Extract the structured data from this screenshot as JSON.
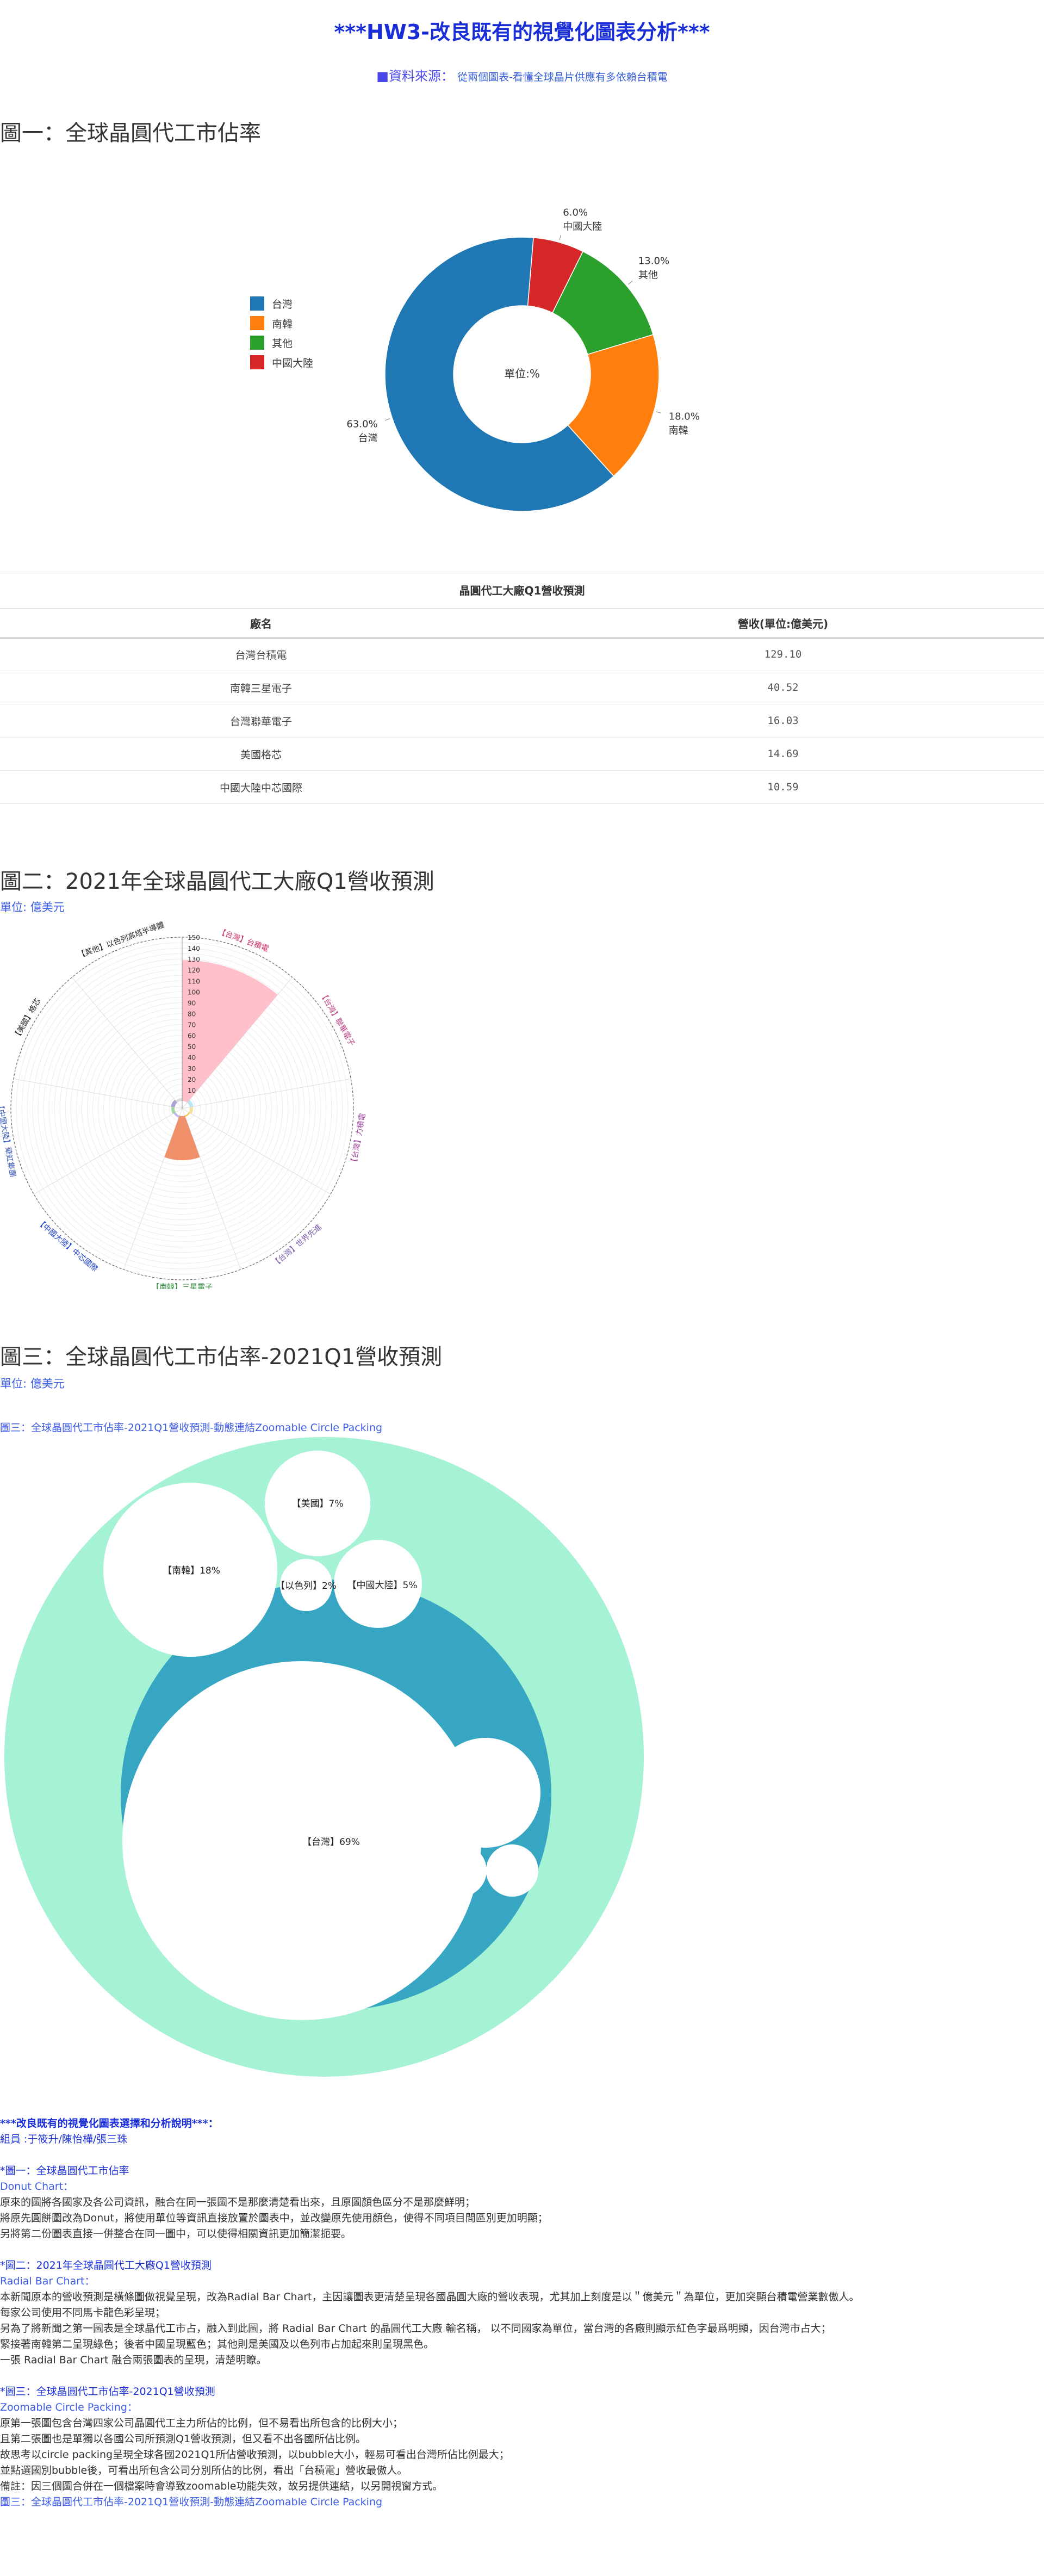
{
  "page": {
    "title": "***HW3-改良既有的視覺化圖表分析***",
    "source_lead": "■資料來源：",
    "source_text": "從兩個圖表-看懂全球晶片供應有多依賴台積電"
  },
  "fig1": {
    "heading": "圖一：全球晶圓代工市佔率",
    "center_label": "單位:%",
    "legend": [
      "台灣",
      "南韓",
      "其他",
      "中國大陸"
    ],
    "colors": [
      "#1f77b4",
      "#ff7f0e",
      "#2ca02c",
      "#d62728"
    ]
  },
  "chart_data": [
    {
      "type": "pie",
      "title": "",
      "categories": [
        "台灣",
        "南韓",
        "其他",
        "中國大陸"
      ],
      "values": [
        63.0,
        18.0,
        13.0,
        6.0
      ],
      "value_labels": [
        "63.0%",
        "18.0%",
        "13.0%",
        "6.0%"
      ],
      "hole": "donut",
      "legend_position": "left",
      "colors": [
        "#1f77b4",
        "#ff7f0e",
        "#2ca02c",
        "#d62728"
      ]
    },
    {
      "type": "table",
      "title": "晶圓代工大廠Q1營收預測",
      "columns": [
        "廠名",
        "營收(單位:億美元)"
      ],
      "rows": [
        [
          "台灣台積電",
          "129.10"
        ],
        [
          "南韓三星電子",
          "40.52"
        ],
        [
          "台灣聯華電子",
          "16.03"
        ],
        [
          "美國格芯",
          "14.69"
        ],
        [
          "中國大陸中芯國際",
          "10.59"
        ]
      ]
    },
    {
      "type": "bar",
      "subtype": "radial",
      "title": "2021年全球晶圓代工大廠Q1營收預測",
      "ylabel": "億美元",
      "categories": [
        "【台灣】台積電",
        "【台灣】聯華電子",
        "【台灣】力積電",
        "【台灣】世界先進",
        "【南韓】三星電子",
        "【中國大陸】中芯國際",
        "【中國大陸】華虹集團",
        "【美國】格芯",
        "【其他】以色列高塔半導體"
      ],
      "values": [
        129.1,
        3.5,
        3.0,
        1.2,
        40.52,
        2.0,
        3.0,
        3.5,
        2.5
      ],
      "ylim": [
        0,
        150
      ],
      "ticks": [
        0,
        10,
        20,
        30,
        40,
        50,
        60,
        70,
        80,
        90,
        100,
        110,
        120,
        130,
        140,
        150
      ],
      "colors": [
        "#ffc0cb",
        "#b9e6f2",
        "#f7dfa0",
        "#f5c842",
        "#f0906a",
        "#c7b7e8",
        "#9fd9a0",
        "#b0a0d8",
        "#dcdcdc"
      ]
    },
    {
      "type": "bubble",
      "subtype": "circle-packing",
      "title": "全球晶圓代工市佔率-2021Q1營收預測",
      "categories": [
        "【台灣】69%",
        "【南韓】18%",
        "【美國】7%",
        "【中國大陸】5%",
        "【以色列】2%"
      ],
      "values": [
        69,
        18,
        7,
        5,
        2
      ],
      "colors": [
        "#36a6c2",
        "#a6f2d4"
      ]
    }
  ],
  "fig2": {
    "heading": "圖二：2021年全球晶圓代工大廠Q1營收預測",
    "unit": "單位: 億美元",
    "tick_labels": [
      "0",
      "10",
      "20",
      "30",
      "40",
      "50",
      "60",
      "70",
      "80",
      "90",
      "100",
      "110",
      "120",
      "130",
      "140",
      "150"
    ],
    "outer_labels": [
      "【台灣】台積電",
      "【台灣】聯華電子",
      "【台灣】力積電",
      "【台灣】世界先進",
      "【南韓】三星電子",
      "【中國大陸】中芯國際",
      "【中國大陸】華虹集團",
      "【美國】格芯",
      "【其他】以色列高塔半導體"
    ]
  },
  "fig3": {
    "heading": "圖三：全球晶圓代工市佔率-2021Q1營收預測",
    "unit": "單位: 億美元",
    "link": "圖三：全球晶圓代工市佔率-2021Q1營收預測-動態連結Zoomable Circle Packing",
    "bubbles": [
      "【台灣】69%",
      "【南韓】18%",
      "【美國】7%",
      "【中國大陸】5%",
      "【以色列】2%"
    ]
  },
  "notes": {
    "header": "***改良既有的視覺化圖表選擇和分析說明***：",
    "members": "組員 :于筱升/陳怡樺/張三珠",
    "s1_title": "*圖一：全球晶圓代工市佔率",
    "s1_type": "Donut Chart：",
    "s1_lines": [
      "原來的圖將各國家及各公司資訊，融合在同一張圖不是那麼清楚看出來，且原圖顏色區分不是那麼鮮明；",
      "將原先圓餅圖改為Donut，將使用單位等資訊直接放置於圖表中，並改變原先使用顏色，使得不同項目間區別更加明顯；",
      "另將第二份圖表直接一併整合在同一圖中，可以使得相關資訊更加簡潔扼要。"
    ],
    "s2_title": "*圖二：2021年全球晶圓代工大廠Q1營收預測",
    "s2_type": "Radial Bar Chart：",
    "s2_lines": [
      "本新聞原本的營收預測是橫條圖做視覺呈現，改為Radial Bar Chart，主因讓圖表更清楚呈現各國晶圓大廠的營收表現，尤其加上刻度是以＂億美元＂為單位，更加突顯台積電營業數傲人。",
      "每家公司使用不同馬卡龍色彩呈現；",
      "另為了將新聞之第一圖表是全球晶代工市占，融入到此圖，將 Radial Bar Chart 的晶圓代工大廠 輸名稱， 以不同國家為單位，當台灣的各廠則顯示紅色字最爲明顯，因台灣市占大；",
      "緊接著南韓第二呈現綠色；後者中國呈現藍色；其他則是美國及以色列市占加起來則呈現黑色。",
      "一張 Radial Bar Chart 融合兩張圖表的呈現，清楚明瞭。"
    ],
    "s3_title": "*圖三：全球晶圓代工市佔率-2021Q1營收預測",
    "s3_type": "Zoomable Circle Packing：",
    "s3_lines": [
      "原第一張圖包含台灣四家公司晶圓代工主力所佔的比例，但不易看出所包含的比例大小；",
      "且第二張圖也是單獨以各國公司所預測Q1營收預測，但又看不出各國所佔比例。",
      "故思考以circle packing呈現全球各國2021Q1所佔營收預測，以bubble大小，輕易可看出台灣所佔比例最大；",
      "並點選國別bubble後，可看出所包含公司分別所佔的比例，看出「台積電」營收最傲人。",
      "備註：因三個圖合併在一個檔案時會導致zoomable功能失效，故另提供連結，以另開視窗方式。"
    ],
    "s3_link": "圖三：全球晶圓代工市佔率-2021Q1營收預測-動態連結Zoomable Circle Packing"
  }
}
